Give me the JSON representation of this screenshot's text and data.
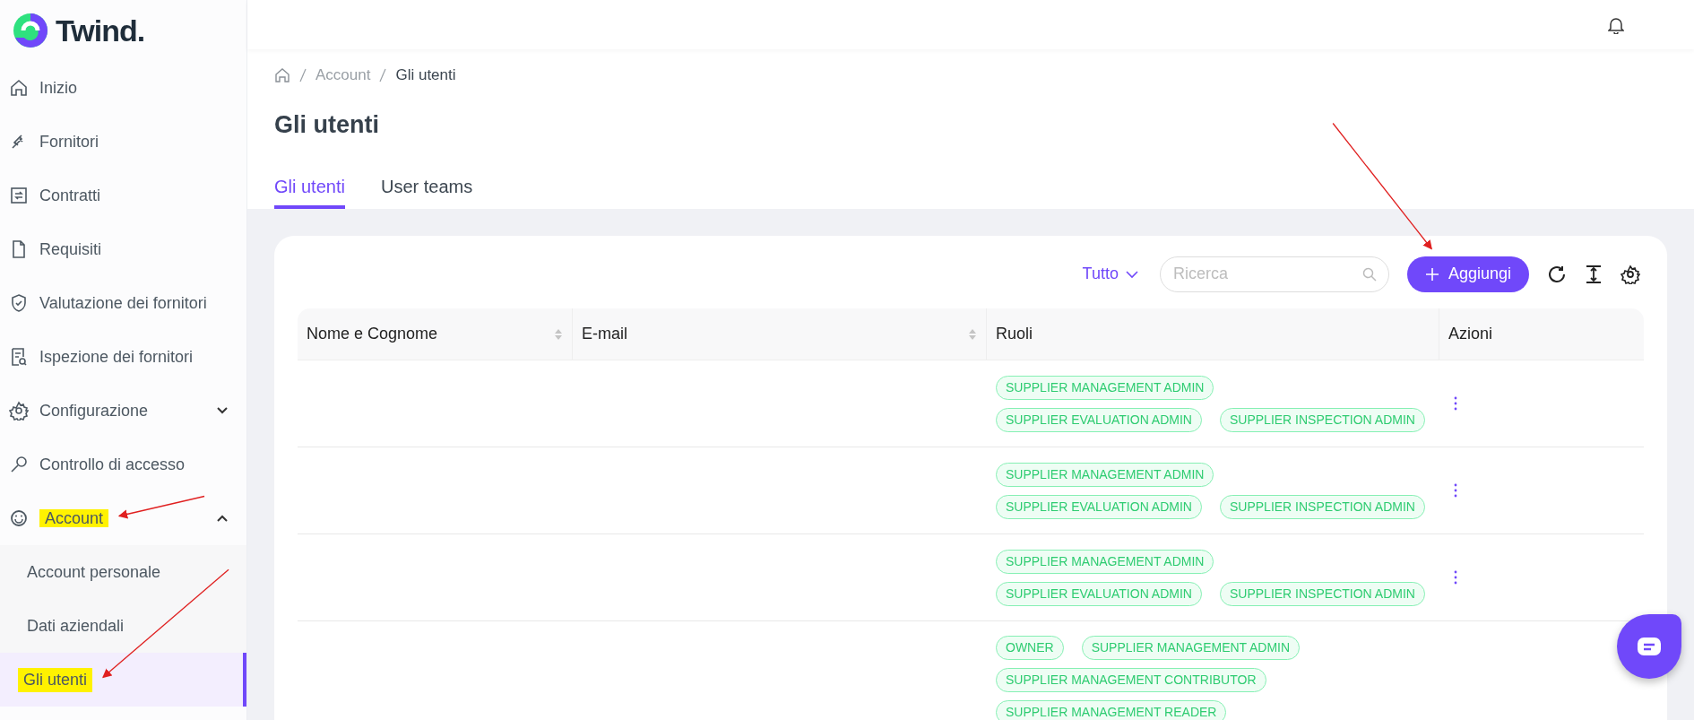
{
  "brand": {
    "name": "Twind."
  },
  "sidebar": {
    "items": [
      {
        "label": "Inizio",
        "highlighted": false
      },
      {
        "label": "Fornitori",
        "highlighted": false
      },
      {
        "label": "Contratti",
        "highlighted": false
      },
      {
        "label": "Requisiti",
        "highlighted": false
      },
      {
        "label": "Valutazione dei fornitori",
        "highlighted": false
      },
      {
        "label": "Ispezione dei fornitori",
        "highlighted": false
      },
      {
        "label": "Configurazione",
        "expanded": false,
        "highlighted": false
      },
      {
        "label": "Controllo di accesso",
        "highlighted": false
      },
      {
        "label": "Account",
        "expanded": true,
        "highlighted": true,
        "children": [
          {
            "label": "Account personale",
            "selected": false,
            "highlighted": false
          },
          {
            "label": "Dati aziendali",
            "selected": false,
            "highlighted": false
          },
          {
            "label": "Gli utenti",
            "selected": true,
            "highlighted": true
          }
        ]
      }
    ]
  },
  "breadcrumb": [
    "Account",
    "Gli utenti"
  ],
  "page_title": "Gli utenti",
  "tabs": [
    {
      "label": "Gli utenti",
      "selected": true
    },
    {
      "label": "User teams",
      "selected": false
    }
  ],
  "toolbar": {
    "filter": "Tutto",
    "search": {
      "placeholder": "Ricerca"
    },
    "add_button": {
      "label": "Aggiungi",
      "pointed": true
    }
  },
  "table": {
    "columns": [
      {
        "label": "Nome e Cognome",
        "sortable": true
      },
      {
        "label": "E-mail",
        "sortable": true
      },
      {
        "label": "Ruoli",
        "sortable": false
      },
      {
        "label": "Azioni",
        "sortable": false
      }
    ],
    "rows": [
      {
        "roles": [
          "SUPPLIER MANAGEMENT ADMIN",
          "SUPPLIER EVALUATION ADMIN",
          "SUPPLIER INSPECTION ADMIN"
        ],
        "has_actions": true
      },
      {
        "roles": [
          "SUPPLIER MANAGEMENT ADMIN",
          "SUPPLIER EVALUATION ADMIN",
          "SUPPLIER INSPECTION ADMIN"
        ],
        "has_actions": true
      },
      {
        "roles": [
          "SUPPLIER MANAGEMENT ADMIN",
          "SUPPLIER EVALUATION ADMIN",
          "SUPPLIER INSPECTION ADMIN"
        ],
        "has_actions": true
      },
      {
        "roles": [
          "OWNER",
          "SUPPLIER MANAGEMENT ADMIN",
          "SUPPLIER MANAGEMENT CONTRIBUTOR",
          "SUPPLIER MANAGEMENT READER"
        ],
        "has_actions": false
      }
    ]
  }
}
